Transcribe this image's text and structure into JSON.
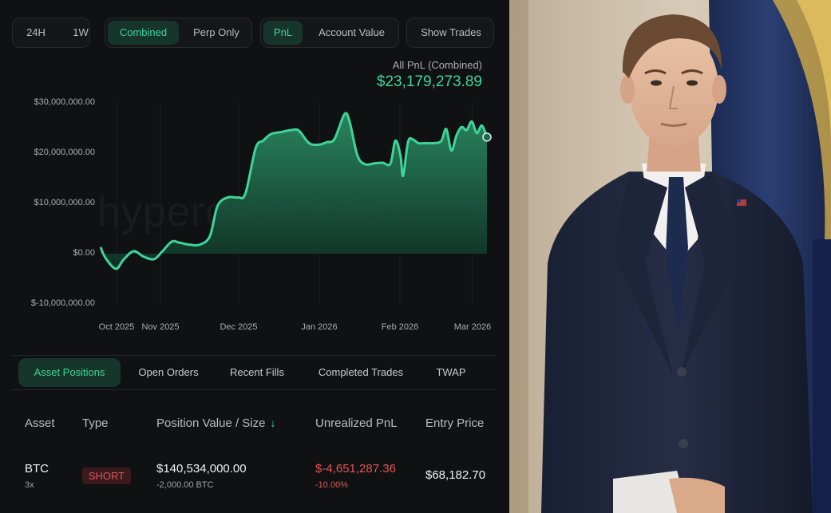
{
  "toolbar": {
    "range": [
      "24H",
      "1W"
    ],
    "mode": [
      "Combined",
      "Perp Only"
    ],
    "metric": [
      "PnL",
      "Account Value"
    ],
    "show_trades": "Show Trades"
  },
  "pnl": {
    "label": "All PnL (Combined)",
    "value": "$23,179,273.89"
  },
  "watermark": "hyperdash.info",
  "chart_data": {
    "type": "area",
    "yticks": [
      "$30,000,000.00",
      "$20,000,000.00",
      "$10,000,000.00",
      "$0.00",
      "$-10,000,000.00"
    ],
    "ylim": [
      -10000000,
      30000000
    ],
    "xticks": [
      "Oct 2025",
      "Nov 2025",
      "Dec 2025",
      "Jan 2026",
      "Feb 2026",
      "Mar 2026"
    ],
    "line_color": "#3fd49a",
    "series": [
      {
        "x": [
          "2025-10-08",
          "2025-10-10",
          "2025-10-14",
          "2025-10-17",
          "2025-10-21",
          "2025-10-25",
          "2025-10-29",
          "2025-11-01",
          "2025-11-05",
          "2025-11-08",
          "2025-11-12",
          "2025-11-16",
          "2025-11-20",
          "2025-11-23",
          "2025-11-27",
          "2025-12-01",
          "2025-12-04",
          "2025-12-08",
          "2025-12-11",
          "2025-12-14",
          "2025-12-18",
          "2025-12-22",
          "2025-12-25",
          "2025-12-29",
          "2026-01-02",
          "2026-01-05",
          "2026-01-08",
          "2026-01-12",
          "2026-01-14",
          "2026-01-17",
          "2026-01-20",
          "2026-01-24",
          "2026-01-27",
          "2026-01-30",
          "2026-02-01",
          "2026-02-03",
          "2026-02-04",
          "2026-02-06",
          "2026-02-08",
          "2026-02-10",
          "2026-02-13",
          "2026-02-16",
          "2026-02-19",
          "2026-02-21",
          "2026-02-23",
          "2026-02-25",
          "2026-02-27",
          "2026-03-01",
          "2026-03-03",
          "2026-03-05",
          "2026-03-07",
          "2026-03-09"
        ],
        "y": [
          1300000,
          -900000,
          -3000000,
          -1200000,
          500000,
          -600000,
          -1100000,
          300000,
          2400000,
          2200000,
          1800000,
          1800000,
          3500000,
          9500000,
          11200000,
          11200000,
          12000000,
          21000000,
          22500000,
          23800000,
          24200000,
          24600000,
          24500000,
          22000000,
          21700000,
          22200000,
          22800000,
          27800000,
          26200000,
          19600000,
          17800000,
          18000000,
          18100000,
          17900000,
          22500000,
          19500000,
          15500000,
          22300000,
          22700000,
          22000000,
          22000000,
          22000000,
          22400000,
          24800000,
          20500000,
          23500000,
          25200000,
          24600000,
          26300000,
          24000000,
          25500000,
          23200000
        ]
      }
    ]
  },
  "tabs": [
    "Asset Positions",
    "Open Orders",
    "Recent Fills",
    "Completed Trades",
    "TWAP"
  ],
  "table": {
    "headers": [
      "Asset",
      "Type",
      "Position Value / Size",
      "Unrealized PnL",
      "Entry Price"
    ],
    "sort_icon": "↓",
    "rows": [
      {
        "asset": "BTC",
        "leverage": "3x",
        "type": "SHORT",
        "value": "$140,534,000.00",
        "size": "-2,000.00 BTC",
        "pnl": "$-4,651,287.36",
        "pnl_pct": "-10.00%",
        "entry": "$68,182.70"
      }
    ]
  },
  "colors": {
    "accent": "#3fd49a",
    "negative": "#e2555b",
    "background": "#101112"
  },
  "icons": [
    "sort-down-icon"
  ]
}
